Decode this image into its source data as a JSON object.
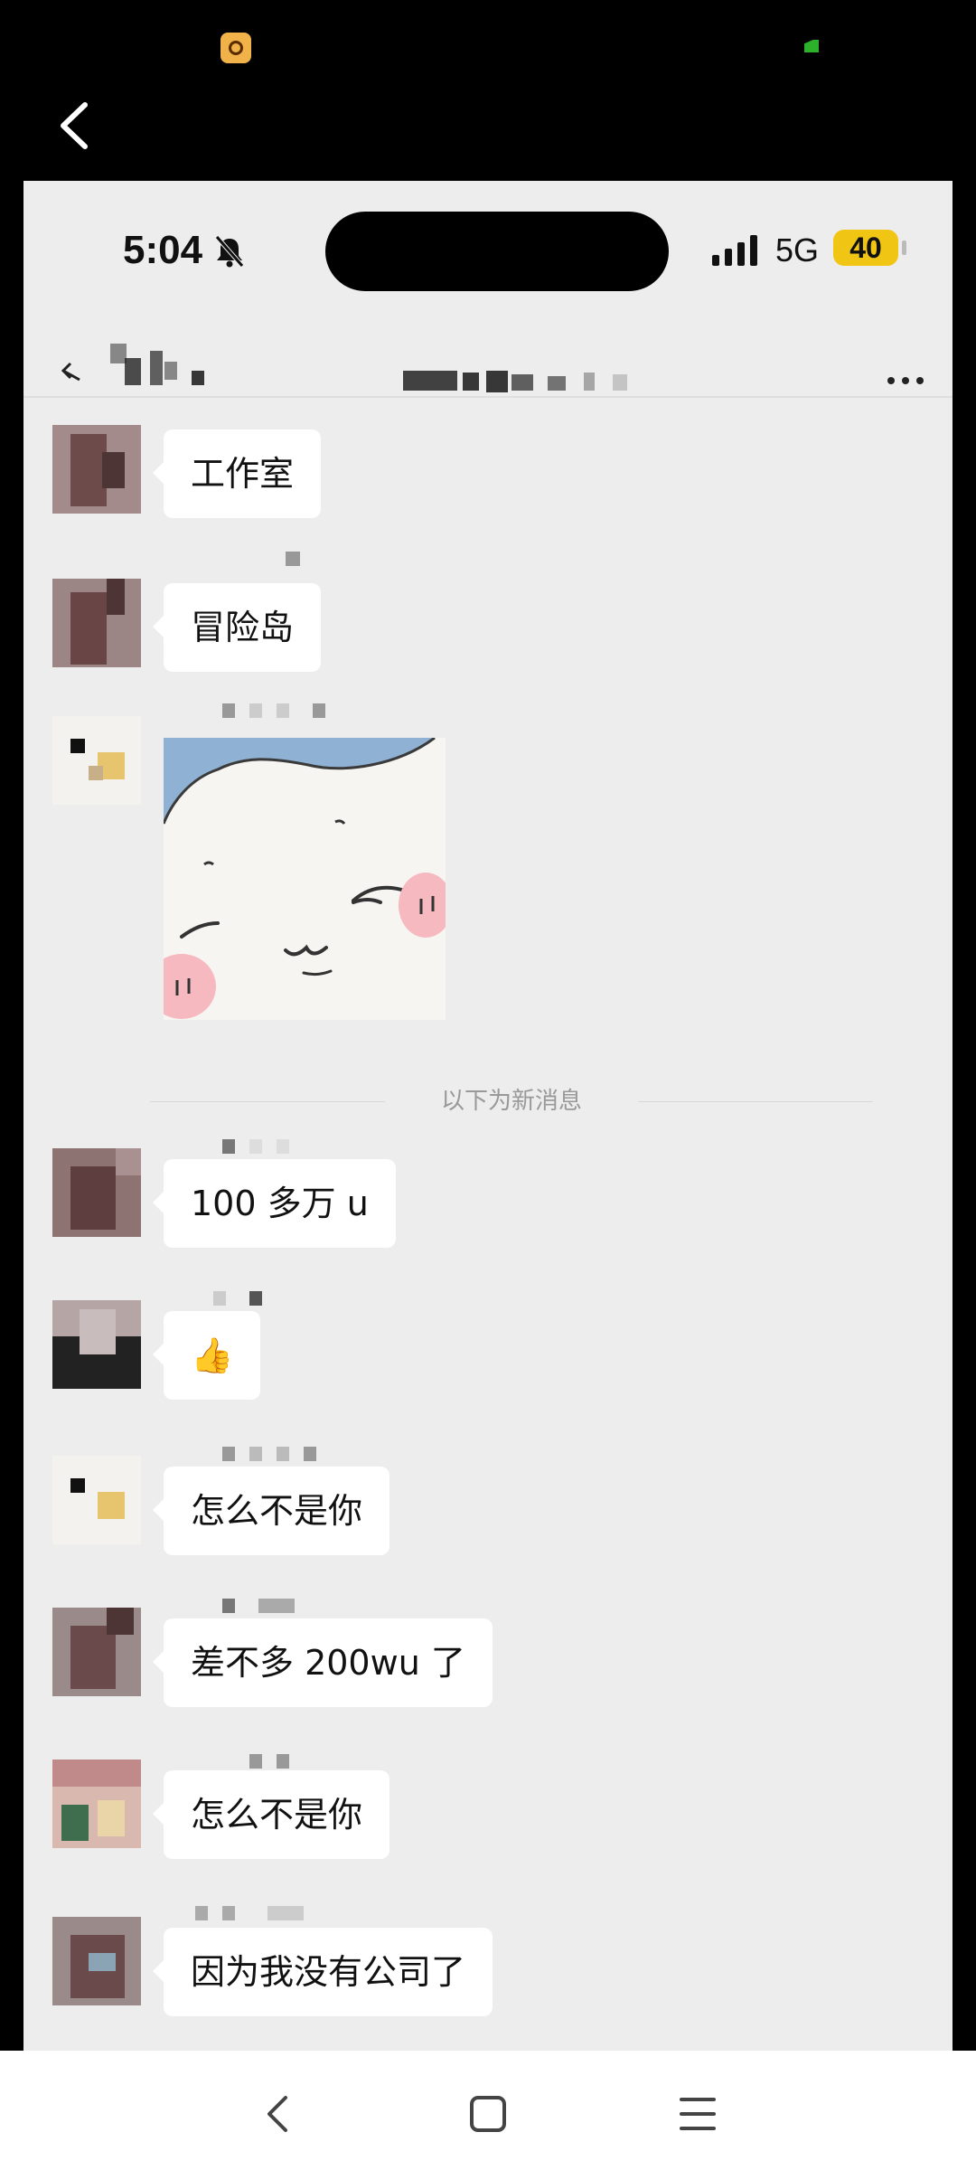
{
  "inner_status": {
    "time": "5:04",
    "network": "5G",
    "battery": "40"
  },
  "divider_label": "以下为新消息",
  "messages": [
    {
      "text": "工作室"
    },
    {
      "text": "冒险岛"
    },
    {
      "text": "100 多万 u"
    },
    {
      "text": "👍"
    },
    {
      "text": "怎么不是你"
    },
    {
      "text": "差不多 200wu 了"
    },
    {
      "text": "怎么不是你"
    },
    {
      "text": "因为我没有公司了"
    }
  ],
  "colors": {
    "background": "#ededed",
    "bubble": "#ffffff",
    "battery": "#f0c514"
  },
  "icons": [
    "app-notification-icon",
    "back-icon",
    "mute-bell-icon",
    "signal-icon",
    "more-icon",
    "nav-back-icon",
    "nav-home-icon",
    "nav-menu-icon"
  ]
}
